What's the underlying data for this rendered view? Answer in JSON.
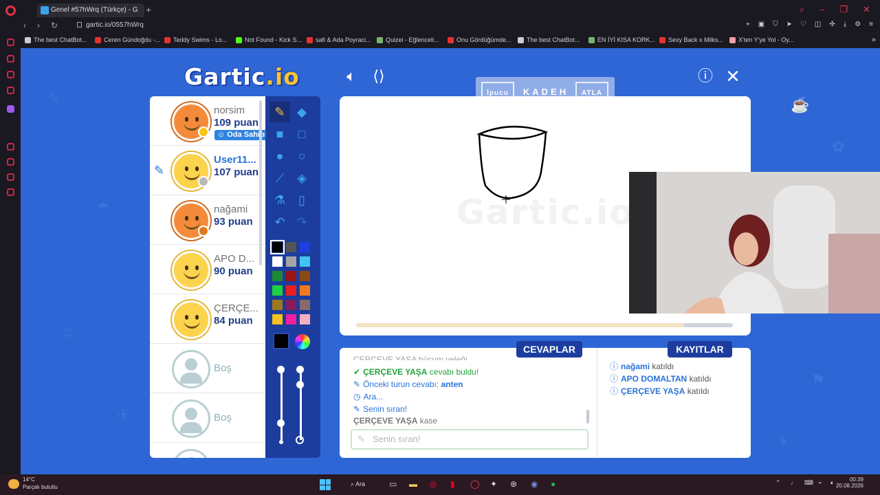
{
  "browser": {
    "tab_title": "Genel #57hWrq (Türkçe) - G",
    "new_tab": "+",
    "url": "gartic.io/0557hWrq",
    "bookmarks": [
      {
        "label": "The best ChatBot...",
        "color": "#cccccc"
      },
      {
        "label": "Ceren Gündoğdu -...",
        "color": "#e63232"
      },
      {
        "label": "Teddy Swims - Lo...",
        "color": "#e63232"
      },
      {
        "label": "Not Found - Kick S...",
        "color": "#53fc18"
      },
      {
        "label": "safi & Ada Poyraci...",
        "color": "#e63232"
      },
      {
        "label": "Quizei - Eğlenceli...",
        "color": "#7bb36b"
      },
      {
        "label": "Onu Gördüğümde...",
        "color": "#e63232"
      },
      {
        "label": "The best ChatBot...",
        "color": "#cccccc"
      },
      {
        "label": "EN İYİ KISA KORK...",
        "color": "#7bb36b"
      },
      {
        "label": "Sexy Back x Milks...",
        "color": "#e63232"
      },
      {
        "label": "X'ten Y'ye Yol - Oy...",
        "color": "#f0a0a0"
      }
    ]
  },
  "game": {
    "logo_main": "Gartic",
    "logo_suffix": ".io",
    "hint_label": "İpucu",
    "hint_word": "KADEH",
    "skip_label": "ATLA",
    "watermark": "Gartic.io",
    "timer_fraction": 0.87,
    "players": [
      {
        "name": "norsim",
        "points": "109 puan",
        "avatar": "orange",
        "dot": "#f5c518",
        "owner": "Oda Sahibi",
        "drawing": false
      },
      {
        "name": "User11...",
        "points": "107 puan",
        "avatar": "yellow",
        "dot": "#b8b8b8",
        "owner": "",
        "drawing": true
      },
      {
        "name": "nağami",
        "points": "93 puan",
        "avatar": "orange",
        "dot": "#e07b1a",
        "owner": "",
        "drawing": false
      },
      {
        "name": "APO D...",
        "points": "90 puan",
        "avatar": "yellow",
        "dot": "",
        "owner": "",
        "drawing": false
      },
      {
        "name": "ÇERÇE...",
        "points": "84 puan",
        "avatar": "yellow",
        "dot": "",
        "owner": "",
        "drawing": false
      }
    ],
    "empty_slot_label": "Boş",
    "palette": [
      "#000000",
      "#555555",
      "#1f3ee0",
      "#ffffff",
      "#a5a5a5",
      "#40c4f0",
      "#1e8a34",
      "#9b1414",
      "#8a4a14",
      "#20d040",
      "#e82020",
      "#f07a20",
      "#a07820",
      "#8a1a5a",
      "#8a6a6a",
      "#f5c020",
      "#f020a0",
      "#f5b0c0"
    ],
    "answers_tab": "CEVAPLAR",
    "logs_tab": "KAYITLAR",
    "answers": {
      "cut_line": "ÇERÇEVE YAŞA hücum yeleği",
      "found_name": "ÇERÇEVE YAŞA",
      "found_suffix": "cevabı buldu!",
      "prev_prefix": "Önceki turun cevabı:",
      "prev_answer": "anten",
      "wait": "Ara...",
      "your_turn": "Senin sıran!",
      "last_name": "ÇERÇEVE YAŞA",
      "last_text": "kase",
      "input_placeholder": "Senin sıran!"
    },
    "logs": [
      {
        "name": "nağami",
        "action": "katıldı"
      },
      {
        "name": "APO DOMALTAN",
        "action": "katıldı"
      },
      {
        "name": "ÇERÇEVE YAŞA",
        "action": "katıldı"
      }
    ]
  },
  "taskbar": {
    "weather_temp": "14°C",
    "weather_cond": "Parçalı bulutlu",
    "search": "Ara",
    "time": "00:39",
    "date": "20.08.2026"
  }
}
